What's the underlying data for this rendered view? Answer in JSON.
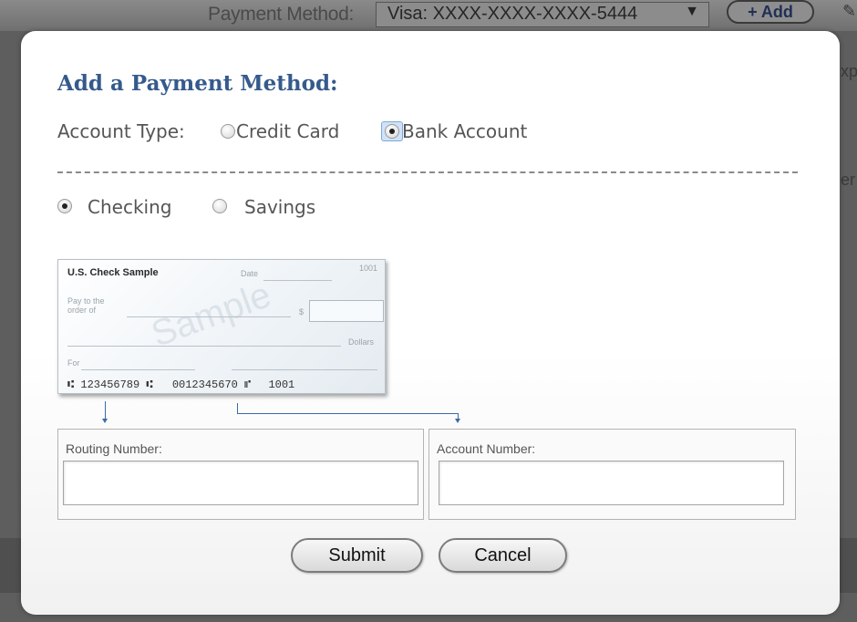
{
  "background": {
    "payment_method_label": "Payment Method:",
    "payment_method_value": "Visa: XXXX-XXXX-XXXX-5444",
    "add_button_label": "+ Add",
    "fragment_1": "xp",
    "fragment_2": "er"
  },
  "modal": {
    "title": "Add a Payment Method:",
    "account_type_label": "Account Type:",
    "account_types": [
      {
        "label": "Credit Card",
        "selected": false
      },
      {
        "label": "Bank Account",
        "selected": true
      }
    ],
    "bank_types": [
      {
        "label": "Checking",
        "selected": true
      },
      {
        "label": "Savings",
        "selected": false
      }
    ],
    "check_sample": {
      "title": "U.S. Check Sample",
      "date_label": "Date",
      "check_number": "1001",
      "pay_to": "Pay to the",
      "order_of": "order of",
      "dollar_sign": "$",
      "dollars": "Dollars",
      "for_label": "For",
      "watermark": "Sample",
      "routing_micr": "⑆ 123456789 ⑆",
      "account_micr": "0012345670 ⑈",
      "micr_check_number": "1001"
    },
    "routing_label": "Routing Number:",
    "routing_value": "",
    "account_label": "Account Number:",
    "account_value": "",
    "submit_label": "Submit",
    "cancel_label": "Cancel"
  },
  "colors": {
    "title": "#355a8c",
    "arrow": "#3d6aa5",
    "overlay": "#5c5c5c"
  }
}
